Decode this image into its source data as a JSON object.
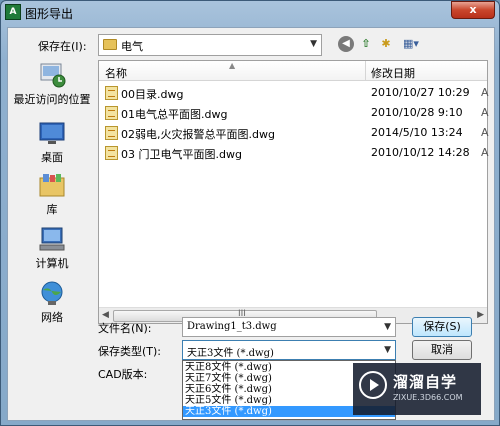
{
  "window": {
    "title": "图形导出",
    "app_icon": "autocad-icon",
    "close_label": "x"
  },
  "toolbar": {
    "savein_label": "保存在(I):",
    "savein_value": "电气",
    "back_glyph": "◀",
    "up_glyph": "⇧",
    "newfolder_glyph": "✱",
    "views_glyph": "▦▾"
  },
  "places": [
    {
      "label": "最近访问的位置",
      "icon": "recent-places-icon"
    },
    {
      "label": "桌面",
      "icon": "desktop-icon"
    },
    {
      "label": "库",
      "icon": "library-icon"
    },
    {
      "label": "计算机",
      "icon": "computer-icon"
    },
    {
      "label": "网络",
      "icon": "network-icon"
    }
  ],
  "filelist": {
    "col_name": "名称",
    "col_date": "修改日期",
    "rows": [
      {
        "name": "00目录.dwg",
        "date": "2010/10/27 10:29",
        "extra": "A"
      },
      {
        "name": "01电气总平面图.dwg",
        "date": "2010/10/28 9:10",
        "extra": "A"
      },
      {
        "name": "02弱电,火灾报警总平面图.dwg",
        "date": "2014/5/10 13:24",
        "extra": "A"
      },
      {
        "name": "03 门卫电气平面图.dwg",
        "date": "2010/10/12 14:28",
        "extra": "A"
      }
    ],
    "scroll_grip": "III"
  },
  "form": {
    "filename_label": "文件名(N):",
    "filename_value": "Drawing1_t3.dwg",
    "filetype_label": "保存类型(T):",
    "filetype_value": "天正3文件 (*.dwg)",
    "cad_label": "CAD版本:",
    "dropdown_options": [
      "天正8文件 (*.dwg)",
      "天正7文件 (*.dwg)",
      "天正6文件 (*.dwg)",
      "天正5文件 (*.dwg)",
      "天正3文件 (*.dwg)"
    ],
    "selected_index": 4,
    "save_label": "保存(S)",
    "cancel_label": "取消"
  },
  "watermark": {
    "title": "溜溜自学",
    "url": "ZIXUE.3D66.COM"
  }
}
